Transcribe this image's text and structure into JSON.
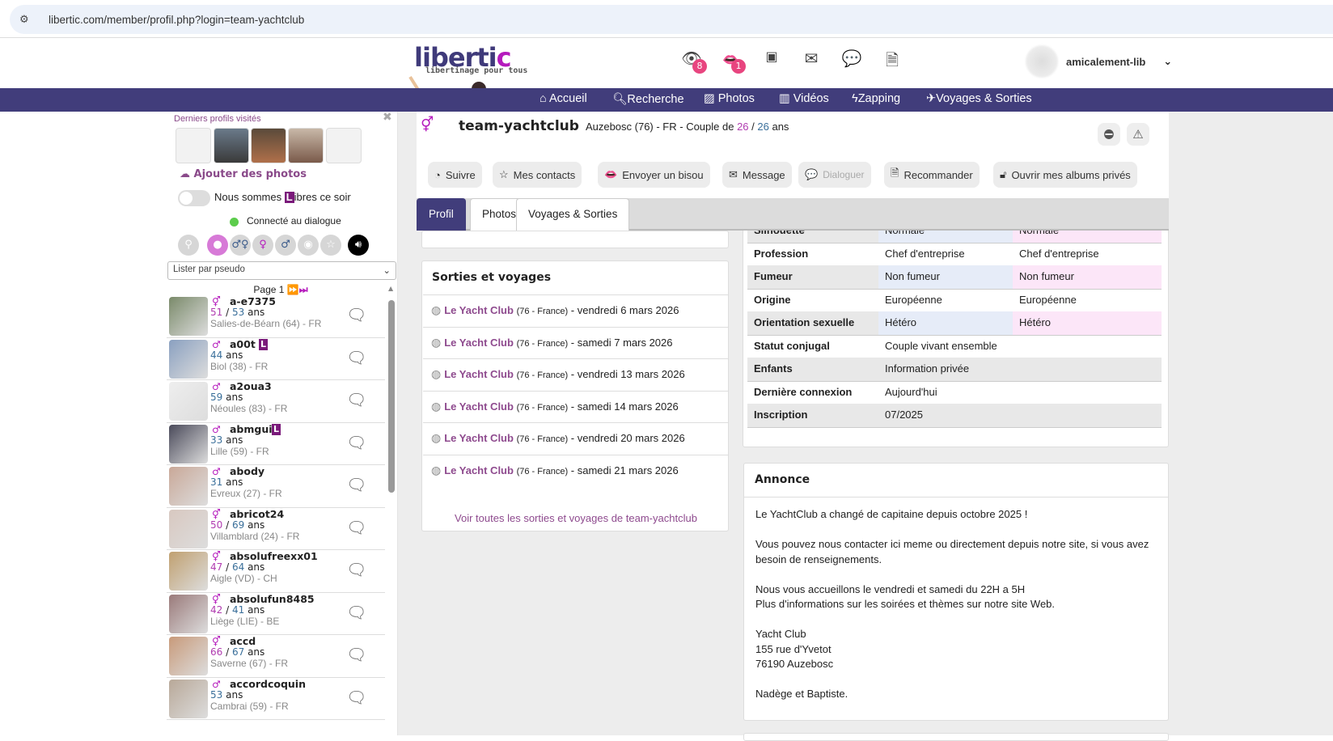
{
  "browser": {
    "url": "libertic.com/member/profil.php?login=team-yachtclub"
  },
  "logo": {
    "word": "liberti",
    "word_end": "c",
    "tagline": "libertinage pour tous"
  },
  "header": {
    "icons": [
      {
        "name": "eye-icon",
        "badge": "8"
      },
      {
        "name": "lips-icon",
        "badge": "1"
      },
      {
        "name": "photo-heart-icon"
      },
      {
        "name": "mail-icon"
      },
      {
        "name": "chat-icon"
      },
      {
        "name": "document-icon"
      }
    ],
    "username": "amicalement-lib"
  },
  "nav": [
    {
      "label": "Accueil",
      "icon": "home-icon"
    },
    {
      "label": "Recherche",
      "icon": "search-icon"
    },
    {
      "label": "Photos",
      "icon": "image-icon"
    },
    {
      "label": "Vidéos",
      "icon": "film-icon"
    },
    {
      "label": "Zapping",
      "icon": "bolt-icon"
    },
    {
      "label": "Voyages & Sorties",
      "icon": "plane-icon"
    }
  ],
  "sidebar": {
    "recent_title": "Derniers profils visités",
    "add_photos": "Ajouter des photos",
    "libres_pre": "Nous sommes ",
    "libres_L": "L",
    "libres_post": "ibres ce soir",
    "connected": "Connecté au dialogue",
    "sort_select": "Lister par pseudo",
    "page_label": "Page 1",
    "list": [
      {
        "name": "a-e7375",
        "type": "couple",
        "age1": "51",
        "age2": "53",
        "location": "Salies-de-Béarn (64) - FR",
        "L": false
      },
      {
        "name": "a00t",
        "type": "man",
        "age2": "44",
        "location": "Biol (38) - FR",
        "L": true
      },
      {
        "name": "a2oua3",
        "type": "man",
        "age2": "59",
        "location": "Néoules (83) - FR",
        "L": false
      },
      {
        "name": "abmgui",
        "type": "man",
        "age2": "33",
        "location": "Lille (59) - FR",
        "L": true
      },
      {
        "name": "abody",
        "type": "man",
        "age2": "31",
        "location": "Evreux (27) - FR",
        "L": false
      },
      {
        "name": "abricot24",
        "type": "couple",
        "age1": "50",
        "age2": "69",
        "location": "Villamblard (24) - FR",
        "L": false
      },
      {
        "name": "absolufreexx01",
        "type": "couple",
        "age1": "47",
        "age2": "64",
        "location": "Aigle (VD) - CH",
        "L": false
      },
      {
        "name": "absolufun8485",
        "type": "couple",
        "age1": "42",
        "age2": "41",
        "location": "Liège (LIE) - BE",
        "L": false
      },
      {
        "name": "accd",
        "type": "couple",
        "age1": "66",
        "age2": "67",
        "location": "Saverne (67) - FR",
        "L": false
      },
      {
        "name": "accordcoquin",
        "type": "man",
        "age2": "53",
        "location": "Cambrai (59) - FR",
        "L": false
      }
    ],
    "ans": "ans"
  },
  "profile": {
    "name": "team-yachtclub",
    "location": "Auzebosc (76) - FR",
    "couple_pre": " - Couple de ",
    "age_f": "26",
    "sep": " / ",
    "age_m": "26",
    "ans": " ans",
    "actions": [
      "Suivre",
      "Mes contacts",
      "Envoyer un bisou",
      "Message",
      "Dialoguer",
      "Recommander",
      "Ouvrir mes albums privés"
    ],
    "tabs": [
      "Profil",
      "Photos",
      "Voyages & Sorties"
    ],
    "details": [
      {
        "k": "Silhouette",
        "v1": "Normale",
        "v2": "Normale"
      },
      {
        "k": "Profession",
        "v1": "Chef d'entreprise",
        "v2": "Chef d'entreprise"
      },
      {
        "k": "Fumeur",
        "v1": "Non fumeur",
        "v2": "Non fumeur"
      },
      {
        "k": "Origine",
        "v1": "Européenne",
        "v2": "Européenne"
      },
      {
        "k": "Orientation sexuelle",
        "v1": "Hétéro",
        "v2": "Hétéro"
      },
      {
        "k": "Statut conjugal",
        "v1": "Couple vivant ensemble",
        "v2": ""
      },
      {
        "k": "Enfants",
        "v1": "Information privée",
        "v2": ""
      },
      {
        "k": "Dernière connexion",
        "v1": "Aujourd'hui",
        "v2": ""
      },
      {
        "k": "Inscription",
        "v1": "07/2025",
        "v2": ""
      }
    ]
  },
  "sorties": {
    "title": "Sorties et voyages",
    "items": [
      {
        "place": "Le Yacht Club",
        "region": "(76 - France)",
        "date": " - vendredi 6 mars 2026"
      },
      {
        "place": "Le Yacht Club",
        "region": "(76 - France)",
        "date": " - samedi 7 mars 2026"
      },
      {
        "place": "Le Yacht Club",
        "region": "(76 - France)",
        "date": " - vendredi 13 mars 2026"
      },
      {
        "place": "Le Yacht Club",
        "region": "(76 - France)",
        "date": " - samedi 14 mars 2026"
      },
      {
        "place": "Le Yacht Club",
        "region": "(76 - France)",
        "date": " - vendredi 20 mars 2026"
      },
      {
        "place": "Le Yacht Club",
        "region": "(76 - France)",
        "date": " - samedi 21 mars 2026"
      }
    ],
    "more": "Voir toutes les sorties et voyages de team-yachtclub"
  },
  "annonce": {
    "title": "Annonce",
    "paragraphs": [
      [
        "Le YachtClub a changé de capitaine depuis octobre 2025 !"
      ],
      [
        "Vous pouvez nous contacter ici meme ou directement depuis notre site, si vous avez besoin de renseignements."
      ],
      [
        "Nous vous accueillons le vendredi et samedi du 22H a 5H",
        "Plus d'informations sur les soirées et thèmes sur notre site Web."
      ],
      [
        "Yacht Club",
        "155 rue d'Yvetot",
        "76190 Auzebosc"
      ],
      [
        "Nadège et Baptiste."
      ]
    ]
  },
  "colors": {
    "nav": "#413d7b",
    "accent": "#b51bbd",
    "link": "#8e4a8e",
    "badge": "#e8457f"
  }
}
